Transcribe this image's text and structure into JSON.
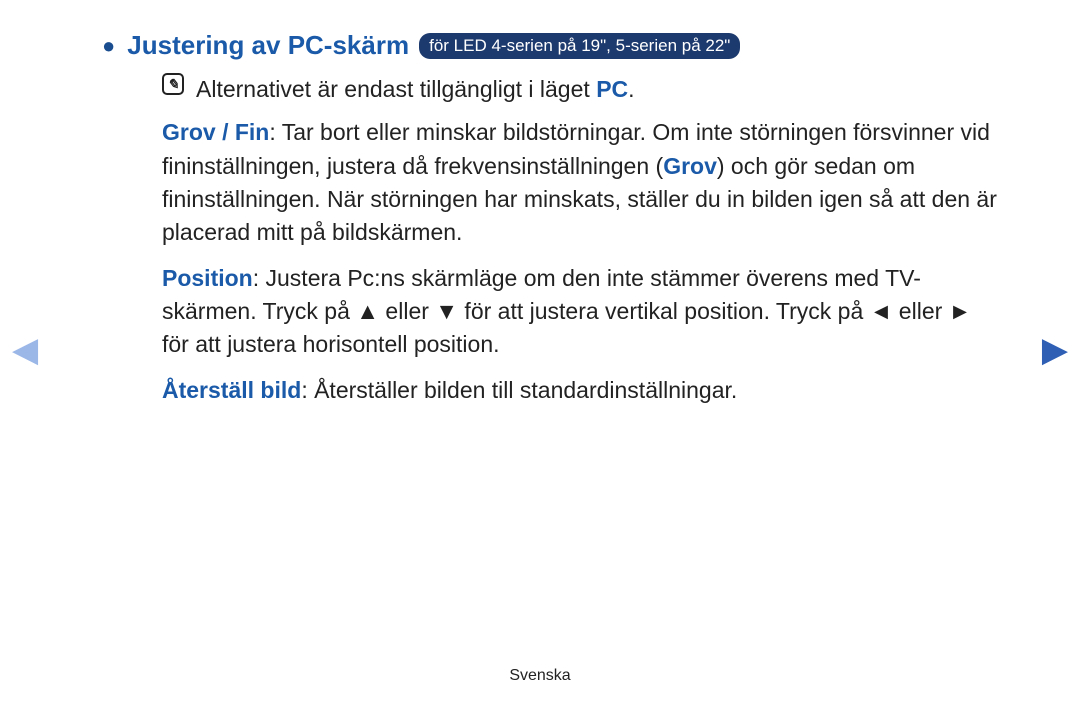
{
  "heading": {
    "title": "Justering av PC-skärm",
    "badge": "för LED 4-serien på 19\", 5-serien på 22\""
  },
  "note": {
    "text_prefix": "Alternativet är endast tillgängligt i läget ",
    "pc_label": "PC",
    "text_suffix": "."
  },
  "grov_fin": {
    "label": "Grov / Fin",
    "text1": ": Tar bort eller minskar bildstörningar. Om inte störningen försvinner vid fininställningen, justera då frekvensinställningen (",
    "grov": "Grov",
    "text2": ") och gör sedan om fininställningen. När störningen har minskats, ställer du in bilden igen så att den är placerad mitt på bildskärmen."
  },
  "position": {
    "label": "Position",
    "text": ": Justera Pc:ns skärmläge om den inte stämmer överens med TV-skärmen. Tryck på ▲ eller ▼ för att justera vertikal position. Tryck på ◄ eller ► för att justera horisontell position."
  },
  "reset": {
    "label": "Återställ bild",
    "text": ": Återställer bilden till standardinställningar."
  },
  "footer": "Svenska",
  "nav": {
    "left": "◀",
    "right": "▶"
  }
}
